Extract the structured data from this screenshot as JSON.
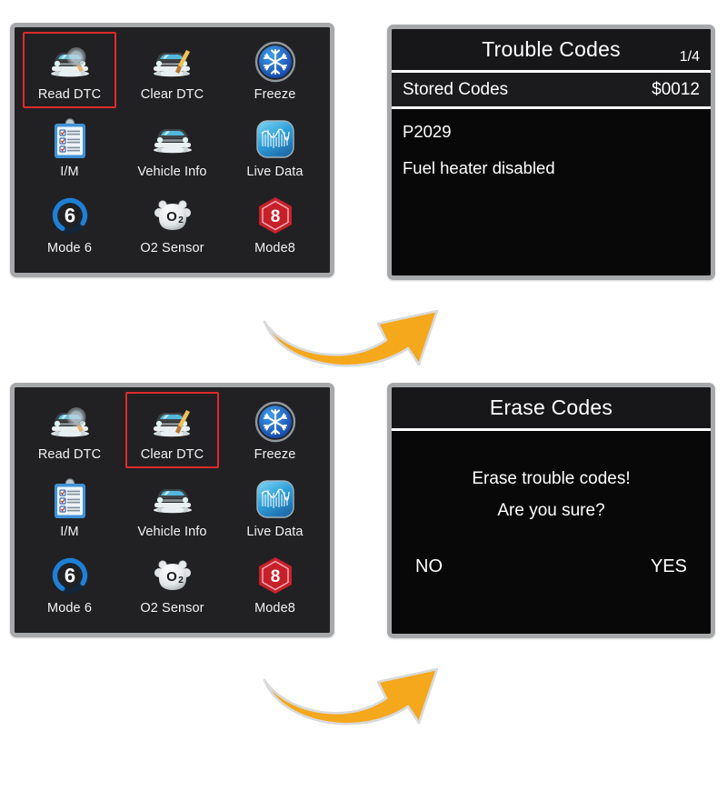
{
  "colors": {
    "frame_border": "#a6a8aa",
    "menu_bg": "#212123",
    "screen_bg": "#080808",
    "selection_red": "#e02b2b",
    "arrow_orange": "#f5a81c",
    "accent_blue": "#1f7fd4",
    "mode8_red": "#c8202a",
    "text_white": "#ffffff"
  },
  "menus": [
    {
      "name": "main-menu-read-dtc",
      "selected": "Read DTC",
      "items": [
        {
          "label": "Read DTC",
          "icon": "car-magnifier-icon"
        },
        {
          "label": "Clear DTC",
          "icon": "car-broom-icon"
        },
        {
          "label": "Freeze",
          "icon": "snowflake-icon"
        },
        {
          "label": "I/M",
          "icon": "clipboard-checklist-icon"
        },
        {
          "label": "Vehicle Info",
          "icon": "car-front-icon"
        },
        {
          "label": "Live Data",
          "icon": "waveform-icon"
        },
        {
          "label": "Mode 6",
          "icon": "ring-six-icon"
        },
        {
          "label": "O2 Sensor",
          "icon": "o2-sensor-icon"
        },
        {
          "label": "Mode8",
          "icon": "hexagon-eight-icon"
        }
      ]
    },
    {
      "name": "main-menu-clear-dtc",
      "selected": "Clear DTC",
      "items": [
        {
          "label": "Read DTC",
          "icon": "car-magnifier-icon"
        },
        {
          "label": "Clear DTC",
          "icon": "car-broom-icon"
        },
        {
          "label": "Freeze",
          "icon": "snowflake-icon"
        },
        {
          "label": "I/M",
          "icon": "clipboard-checklist-icon"
        },
        {
          "label": "Vehicle Info",
          "icon": "car-front-icon"
        },
        {
          "label": "Live Data",
          "icon": "waveform-icon"
        },
        {
          "label": "Mode 6",
          "icon": "ring-six-icon"
        },
        {
          "label": "O2 Sensor",
          "icon": "o2-sensor-icon"
        },
        {
          "label": "Mode8",
          "icon": "hexagon-eight-icon"
        }
      ]
    }
  ],
  "trouble_codes_screen": {
    "title": "Trouble Codes",
    "page_indicator": "1/4",
    "row_label": "Stored Codes",
    "row_value": "$0012",
    "code": "P2029",
    "description": "Fuel heater disabled"
  },
  "erase_codes_screen": {
    "title": "Erase Codes",
    "message_line1": "Erase trouble codes!",
    "message_line2": "Are you sure?",
    "no_label": "NO",
    "yes_label": "YES"
  },
  "arrows": [
    {
      "name": "flow-arrow-top",
      "direction": "curved-up-right"
    },
    {
      "name": "flow-arrow-bottom",
      "direction": "curved-up-right"
    }
  ]
}
